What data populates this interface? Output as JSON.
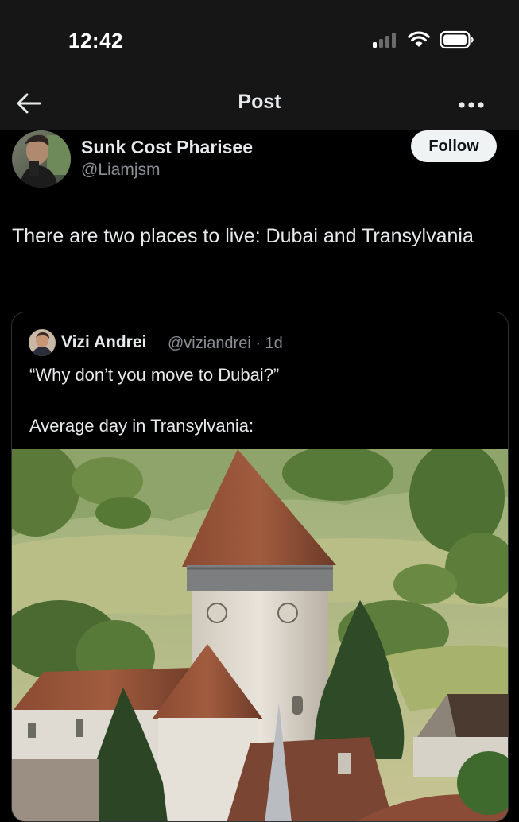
{
  "status": {
    "time": "12:42"
  },
  "nav": {
    "title": "Post"
  },
  "author": {
    "name": "Sunk Cost Pharisee",
    "handle": "@Liamjsm",
    "follow_label": "Follow"
  },
  "tweet": {
    "text": "There are two places to live: Dubai and Transylvania"
  },
  "quoted": {
    "name": "Vizi Andrei",
    "meta": "@viziandrei · 1d",
    "line1": "“Why don’t you move to Dubai?”",
    "line2": "Average day in Transylvania:"
  },
  "colors": {
    "background": "#000000",
    "bar": "#161616",
    "text": "#e7e9ea",
    "muted": "#8b8f94",
    "border": "#2f3336"
  },
  "icons": [
    "back-arrow-icon",
    "more-icon",
    "signal-icon",
    "wifi-icon",
    "battery-icon"
  ]
}
